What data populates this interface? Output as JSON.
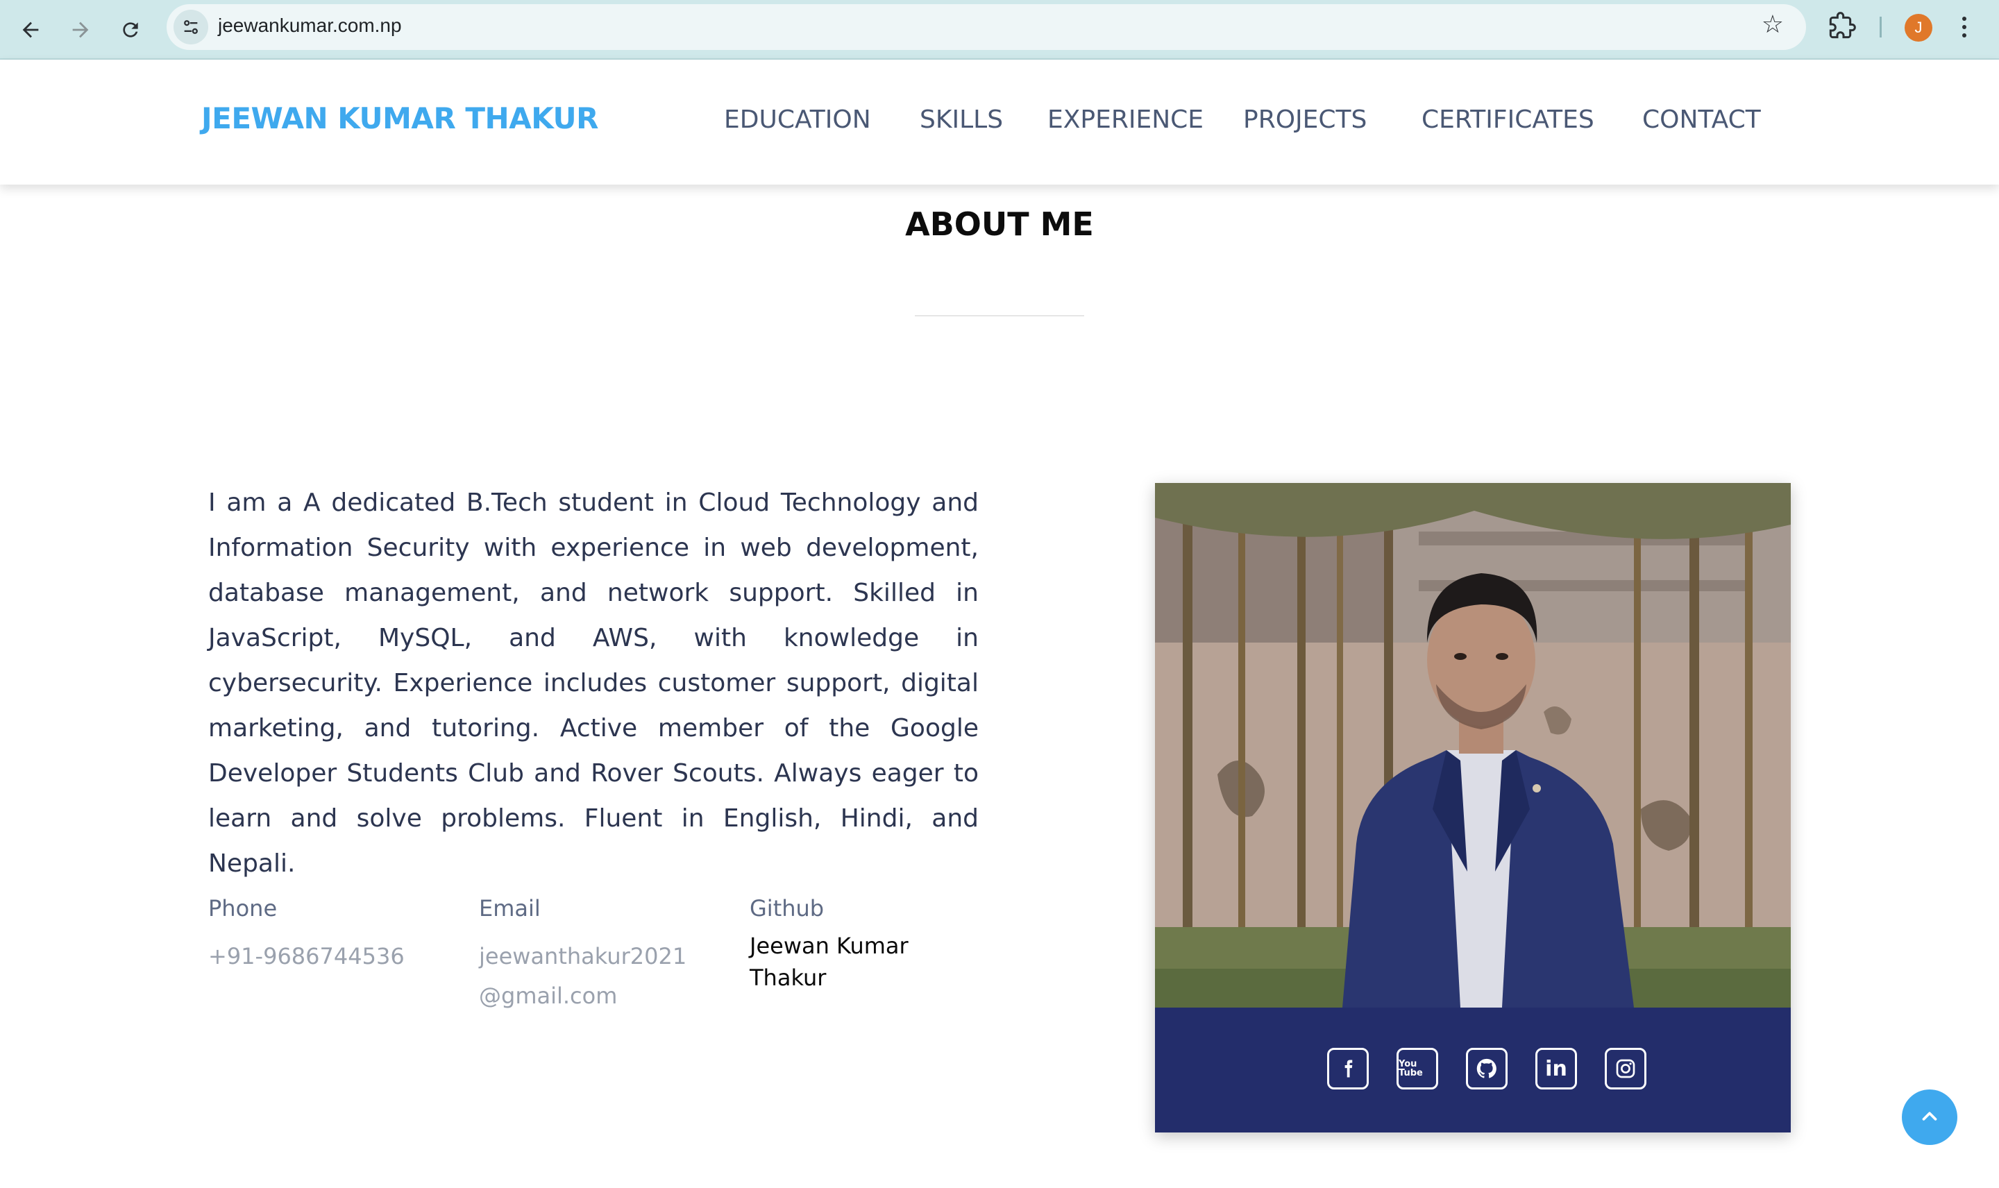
{
  "browser": {
    "url": "jeewankumar.com.np",
    "profile_initial": "J"
  },
  "header": {
    "brand": "JEEWAN KUMAR THAKUR",
    "nav": [
      "EDUCATION",
      "SKILLS",
      "EXPERIENCE",
      "PROJECTS",
      "CERTIFICATES",
      "CONTACT"
    ]
  },
  "about": {
    "title": "ABOUT ME",
    "bio": "I am a A dedicated B.Tech student in Cloud Technology and Information Security with experience in web development, database management, and network support. Skilled in JavaScript, MySQL, and AWS, with knowledge in cybersecurity. Experience includes customer support, digital marketing, and tutoring. Active member of the Google Developer Students Club and Rover Scouts. Always eager to learn and solve problems. Fluent in English, Hindi, and Nepali.",
    "phone_label": "Phone",
    "phone_value": "+91-9686744536",
    "email_label": "Email",
    "email_value": "jeewanthakur2021@gmail.com",
    "github_label": "Github",
    "github_value": "Jeewan Kumar Thakur"
  },
  "social": {
    "icons": [
      "facebook-icon",
      "youtube-icon",
      "github-icon",
      "linkedin-icon",
      "instagram-icon"
    ],
    "youtube_glyph": "You Tube",
    "linkedin_glyph": "in"
  },
  "colors": {
    "brand": "#3fa9ee",
    "nav_text": "#4a5874",
    "card_bar": "#232d6b",
    "chrome_bg": "#cfe8ea"
  }
}
